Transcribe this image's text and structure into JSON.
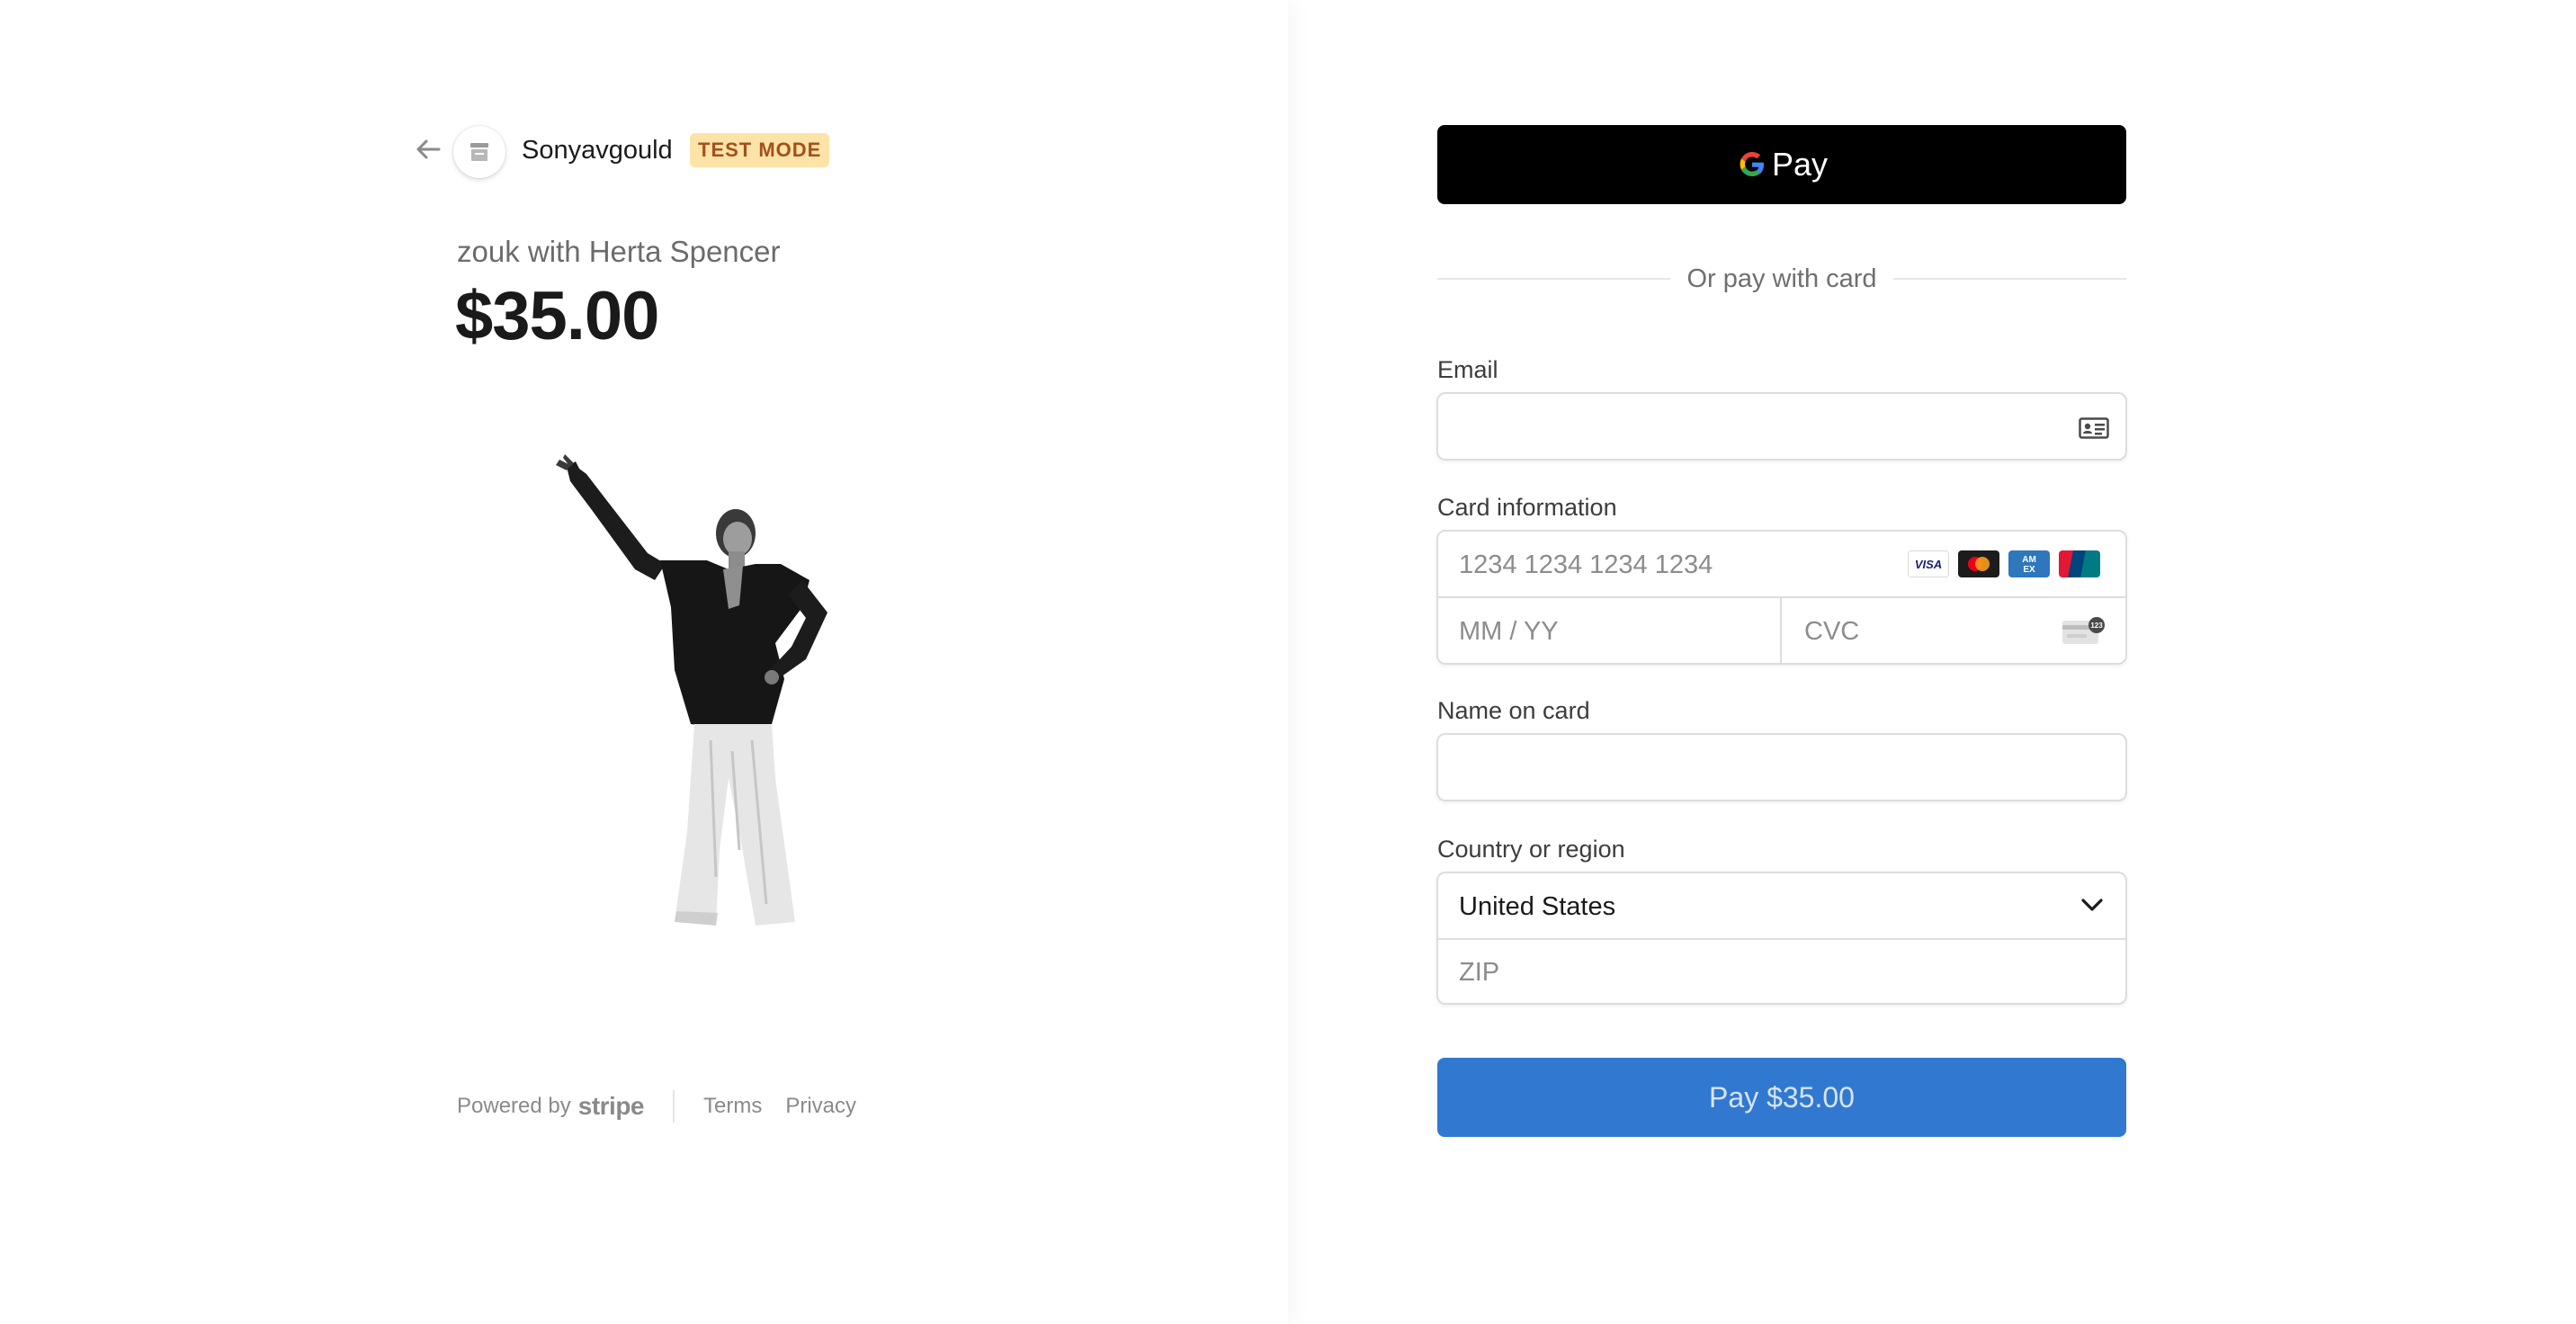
{
  "merchant": {
    "name": "Sonyavgould",
    "badge": "TEST MODE"
  },
  "product": {
    "name": "zouk with Herta Spencer",
    "price": "$35.00"
  },
  "footer": {
    "powered_by": "Powered by",
    "brand": "stripe",
    "terms": "Terms",
    "privacy": "Privacy"
  },
  "gpay": {
    "label": "Pay"
  },
  "divider": {
    "text": "Or pay with card"
  },
  "form": {
    "email_label": "Email",
    "card_label": "Card information",
    "card_number_placeholder": "1234 1234 1234 1234",
    "expiry_placeholder": "MM / YY",
    "cvc_placeholder": "CVC",
    "name_label": "Name on card",
    "country_label": "Country or region",
    "country_value": "United States",
    "zip_placeholder": "ZIP"
  },
  "card_brands": [
    "VISA",
    "Mastercard",
    "American Express",
    "UnionPay"
  ],
  "pay_button": {
    "label": "Pay $35.00"
  },
  "colors": {
    "badge_bg": "#fde3a7",
    "badge_text": "#a3501c",
    "pay_button": "#3178d1",
    "gpay_bg": "#000000"
  }
}
